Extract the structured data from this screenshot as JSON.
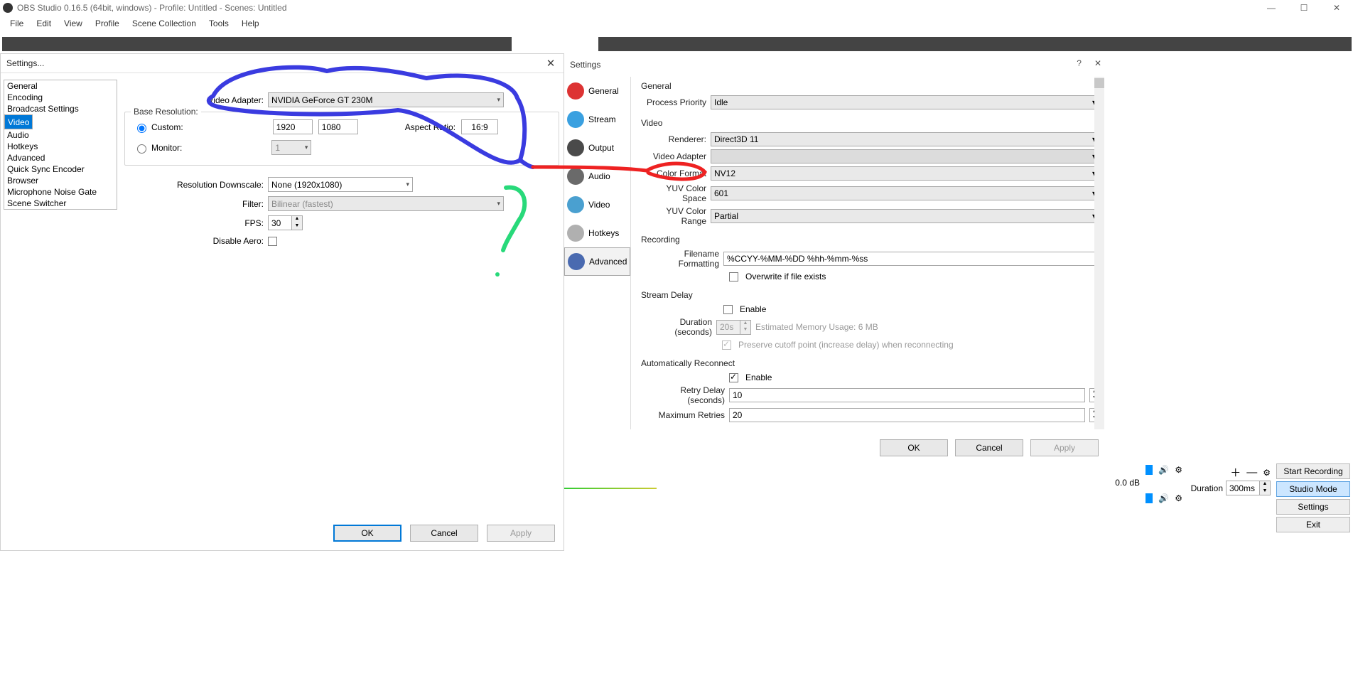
{
  "window": {
    "title": "OBS Studio 0.16.5 (64bit, windows) - Profile: Untitled - Scenes: Untitled",
    "menu": [
      "File",
      "Edit",
      "View",
      "Profile",
      "Scene Collection",
      "Tools",
      "Help"
    ]
  },
  "old_settings": {
    "title": "Settings...",
    "nav": [
      "General",
      "Encoding",
      "Broadcast Settings",
      "Video",
      "Audio",
      "Hotkeys",
      "Advanced",
      "Quick Sync Encoder",
      "Browser",
      "Microphone Noise Gate",
      "Scene Switcher"
    ],
    "nav_selected": "Video",
    "video_adapter_label": "Video Adapter:",
    "video_adapter_value": "NVIDIA GeForce GT 230M",
    "base_res_label": "Base Resolution:",
    "custom_label": "Custom:",
    "custom_w": "1920",
    "custom_h": "1080",
    "aspect_label": "Aspect Ratio:",
    "aspect_value": "16:9",
    "monitor_label": "Monitor:",
    "monitor_value": "1",
    "downscale_label": "Resolution Downscale:",
    "downscale_value": "None  (1920x1080)",
    "filter_label": "Filter:",
    "filter_value": "Bilinear (fastest)",
    "fps_label": "FPS:",
    "fps_value": "30",
    "disable_aero_label": "Disable Aero:",
    "buttons": {
      "ok": "OK",
      "cancel": "Cancel",
      "apply": "Apply"
    }
  },
  "new_settings": {
    "title": "Settings",
    "nav": [
      "General",
      "Stream",
      "Output",
      "Audio",
      "Video",
      "Hotkeys",
      "Advanced"
    ],
    "nav_selected": "Advanced",
    "general": {
      "heading": "General",
      "priority_label": "Process Priority",
      "priority_value": "Idle"
    },
    "video": {
      "heading": "Video",
      "renderer_label": "Renderer:",
      "renderer_value": "Direct3D 11",
      "adapter_label": "Video Adapter",
      "adapter_value": "",
      "cfmt_label": "Color Format",
      "cfmt_value": "NV12",
      "cspace_label": "YUV Color Space",
      "cspace_value": "601",
      "crange_label": "YUV Color Range",
      "crange_value": "Partial"
    },
    "recording": {
      "heading": "Recording",
      "fname_label": "Filename Formatting",
      "fname_value": "%CCYY-%MM-%DD %hh-%mm-%ss",
      "overwrite_label": "Overwrite if file exists"
    },
    "delay": {
      "heading": "Stream Delay",
      "enable_label": "Enable",
      "duration_label": "Duration (seconds)",
      "duration_value": "20s",
      "memory_label": "Estimated Memory Usage: 6 MB",
      "preserve_label": "Preserve cutoff point (increase delay) when reconnecting"
    },
    "reconnect": {
      "heading": "Automatically Reconnect",
      "enable_label": "Enable",
      "retry_label": "Retry Delay (seconds)",
      "retry_value": "10",
      "max_label": "Maximum Retries",
      "max_value": "20"
    },
    "buttons": {
      "ok": "OK",
      "cancel": "Cancel",
      "apply": "Apply"
    }
  },
  "main": {
    "db_label": "0.0 dB",
    "transition": {
      "duration_label": "Duration",
      "duration_value": "300ms"
    },
    "side_buttons": {
      "start_rec": "Start Recording",
      "studio": "Studio Mode",
      "settings": "Settings",
      "exit": "Exit"
    }
  }
}
